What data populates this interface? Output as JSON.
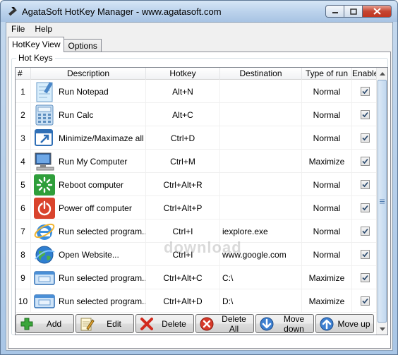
{
  "window": {
    "title": "AgataSoft HotKey Manager  -  www.agatasoft.com"
  },
  "menu": {
    "file": "File",
    "help": "Help"
  },
  "tabs": {
    "hotkey_view": "HotKey View",
    "options": "Options"
  },
  "group_label": "Hot Keys",
  "columns": {
    "num": "#",
    "description": "Description",
    "hotkey": "Hotkey",
    "destination": "Destination",
    "type_of_run": "Type of run",
    "enabled": "Enabled"
  },
  "rows": [
    {
      "num": "1",
      "description": "Run Notepad",
      "hotkey": "Alt+N",
      "destination": "",
      "run": "Normal",
      "enabled": true,
      "icon": "notepad-icon"
    },
    {
      "num": "2",
      "description": "Run Calc",
      "hotkey": "Alt+C",
      "destination": "",
      "run": "Normal",
      "enabled": true,
      "icon": "calculator-icon"
    },
    {
      "num": "3",
      "description": "Minimize/Maximaze all ...",
      "hotkey": "Ctrl+D",
      "destination": "",
      "run": "Normal",
      "enabled": true,
      "icon": "windows-icon"
    },
    {
      "num": "4",
      "description": "Run My Computer",
      "hotkey": "Ctrl+M",
      "destination": "",
      "run": "Maximize",
      "enabled": true,
      "icon": "computer-icon"
    },
    {
      "num": "5",
      "description": "Reboot computer",
      "hotkey": "Ctrl+Alt+R",
      "destination": "",
      "run": "Normal",
      "enabled": true,
      "icon": "reboot-icon"
    },
    {
      "num": "6",
      "description": "Power off computer",
      "hotkey": "Ctrl+Alt+P",
      "destination": "",
      "run": "Normal",
      "enabled": true,
      "icon": "power-icon"
    },
    {
      "num": "7",
      "description": "Run selected program...",
      "hotkey": "Ctrl+I",
      "destination": "iexplore.exe",
      "run": "Normal",
      "enabled": true,
      "icon": "internet-explorer-icon"
    },
    {
      "num": "8",
      "description": "Open Website...",
      "hotkey": "Ctrl+I",
      "destination": "www.google.com",
      "run": "Normal",
      "enabled": true,
      "icon": "globe-icon"
    },
    {
      "num": "9",
      "description": "Run selected program...",
      "hotkey": "Ctrl+Alt+C",
      "destination": "C:\\",
      "run": "Maximize",
      "enabled": true,
      "icon": "program-window-icon"
    },
    {
      "num": "10",
      "description": "Run selected program...",
      "hotkey": "Ctrl+Alt+D",
      "destination": "D:\\",
      "run": "Maximize",
      "enabled": true,
      "icon": "program-window-icon"
    }
  ],
  "buttons": {
    "add": "Add",
    "edit": "Edit",
    "delete": "Delete",
    "delete_all": "Delete All",
    "move_down": "Move down",
    "move_up": "Move up"
  },
  "watermark": "download",
  "colors": {
    "accent": "#2f5f9e",
    "title_bar": "#bcd3ec",
    "close": "#c54531"
  }
}
